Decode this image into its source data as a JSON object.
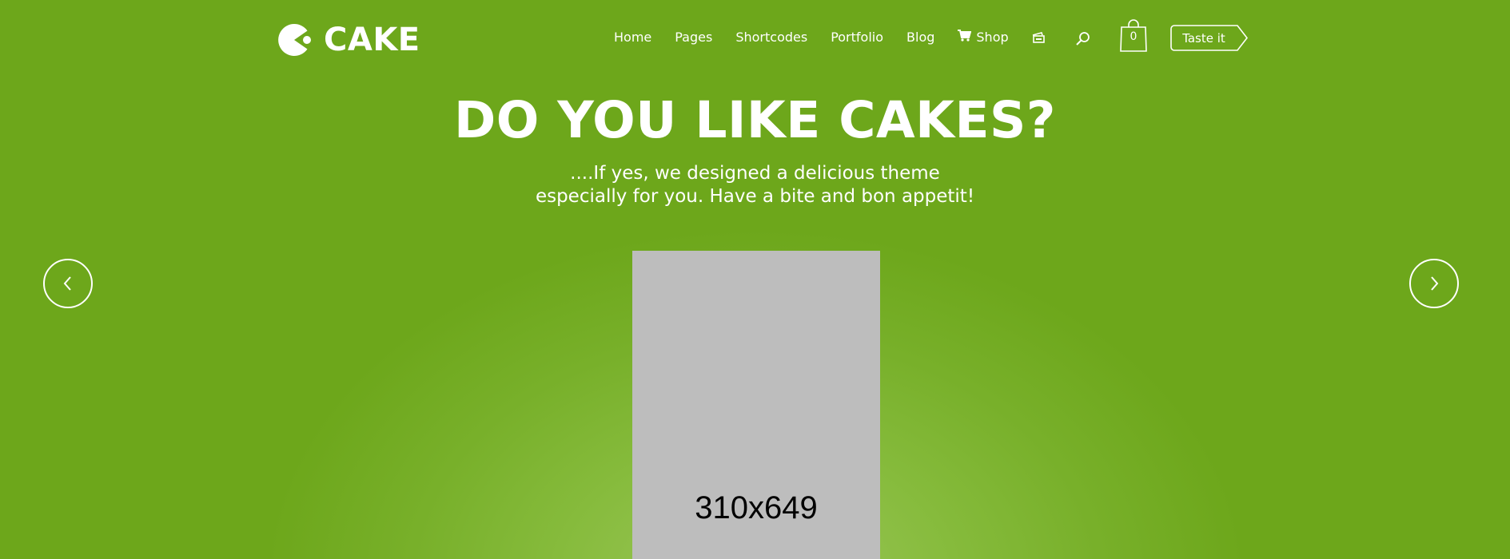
{
  "brand": {
    "name": "CAKE",
    "logo_icon": "pacman-cake-icon"
  },
  "nav": {
    "items": [
      {
        "label": "Home"
      },
      {
        "label": "Pages"
      },
      {
        "label": "Shortcodes"
      },
      {
        "label": "Portfolio"
      },
      {
        "label": "Blog"
      },
      {
        "label": "Shop",
        "icon": "shopping-cart-icon"
      }
    ],
    "extra_icon": "ticket-icon",
    "search_icon": "search-icon"
  },
  "cart": {
    "count": "0",
    "icon": "shopping-bag-icon"
  },
  "cta": {
    "label": "Taste it"
  },
  "hero": {
    "title": "DO YOU LIKE CAKES?",
    "subtitle_line1": "....If yes, we designed a delicious theme",
    "subtitle_line2": "especially for you. Have a bite and bon appetit!"
  },
  "slider": {
    "prev_icon": "chevron-left-icon",
    "next_icon": "chevron-right-icon",
    "image_placeholder": "310x649"
  },
  "colors": {
    "background": "#6da71b",
    "glow": "#9cc75a",
    "placeholder": "#bdbdbd",
    "text": "#ffffff"
  }
}
